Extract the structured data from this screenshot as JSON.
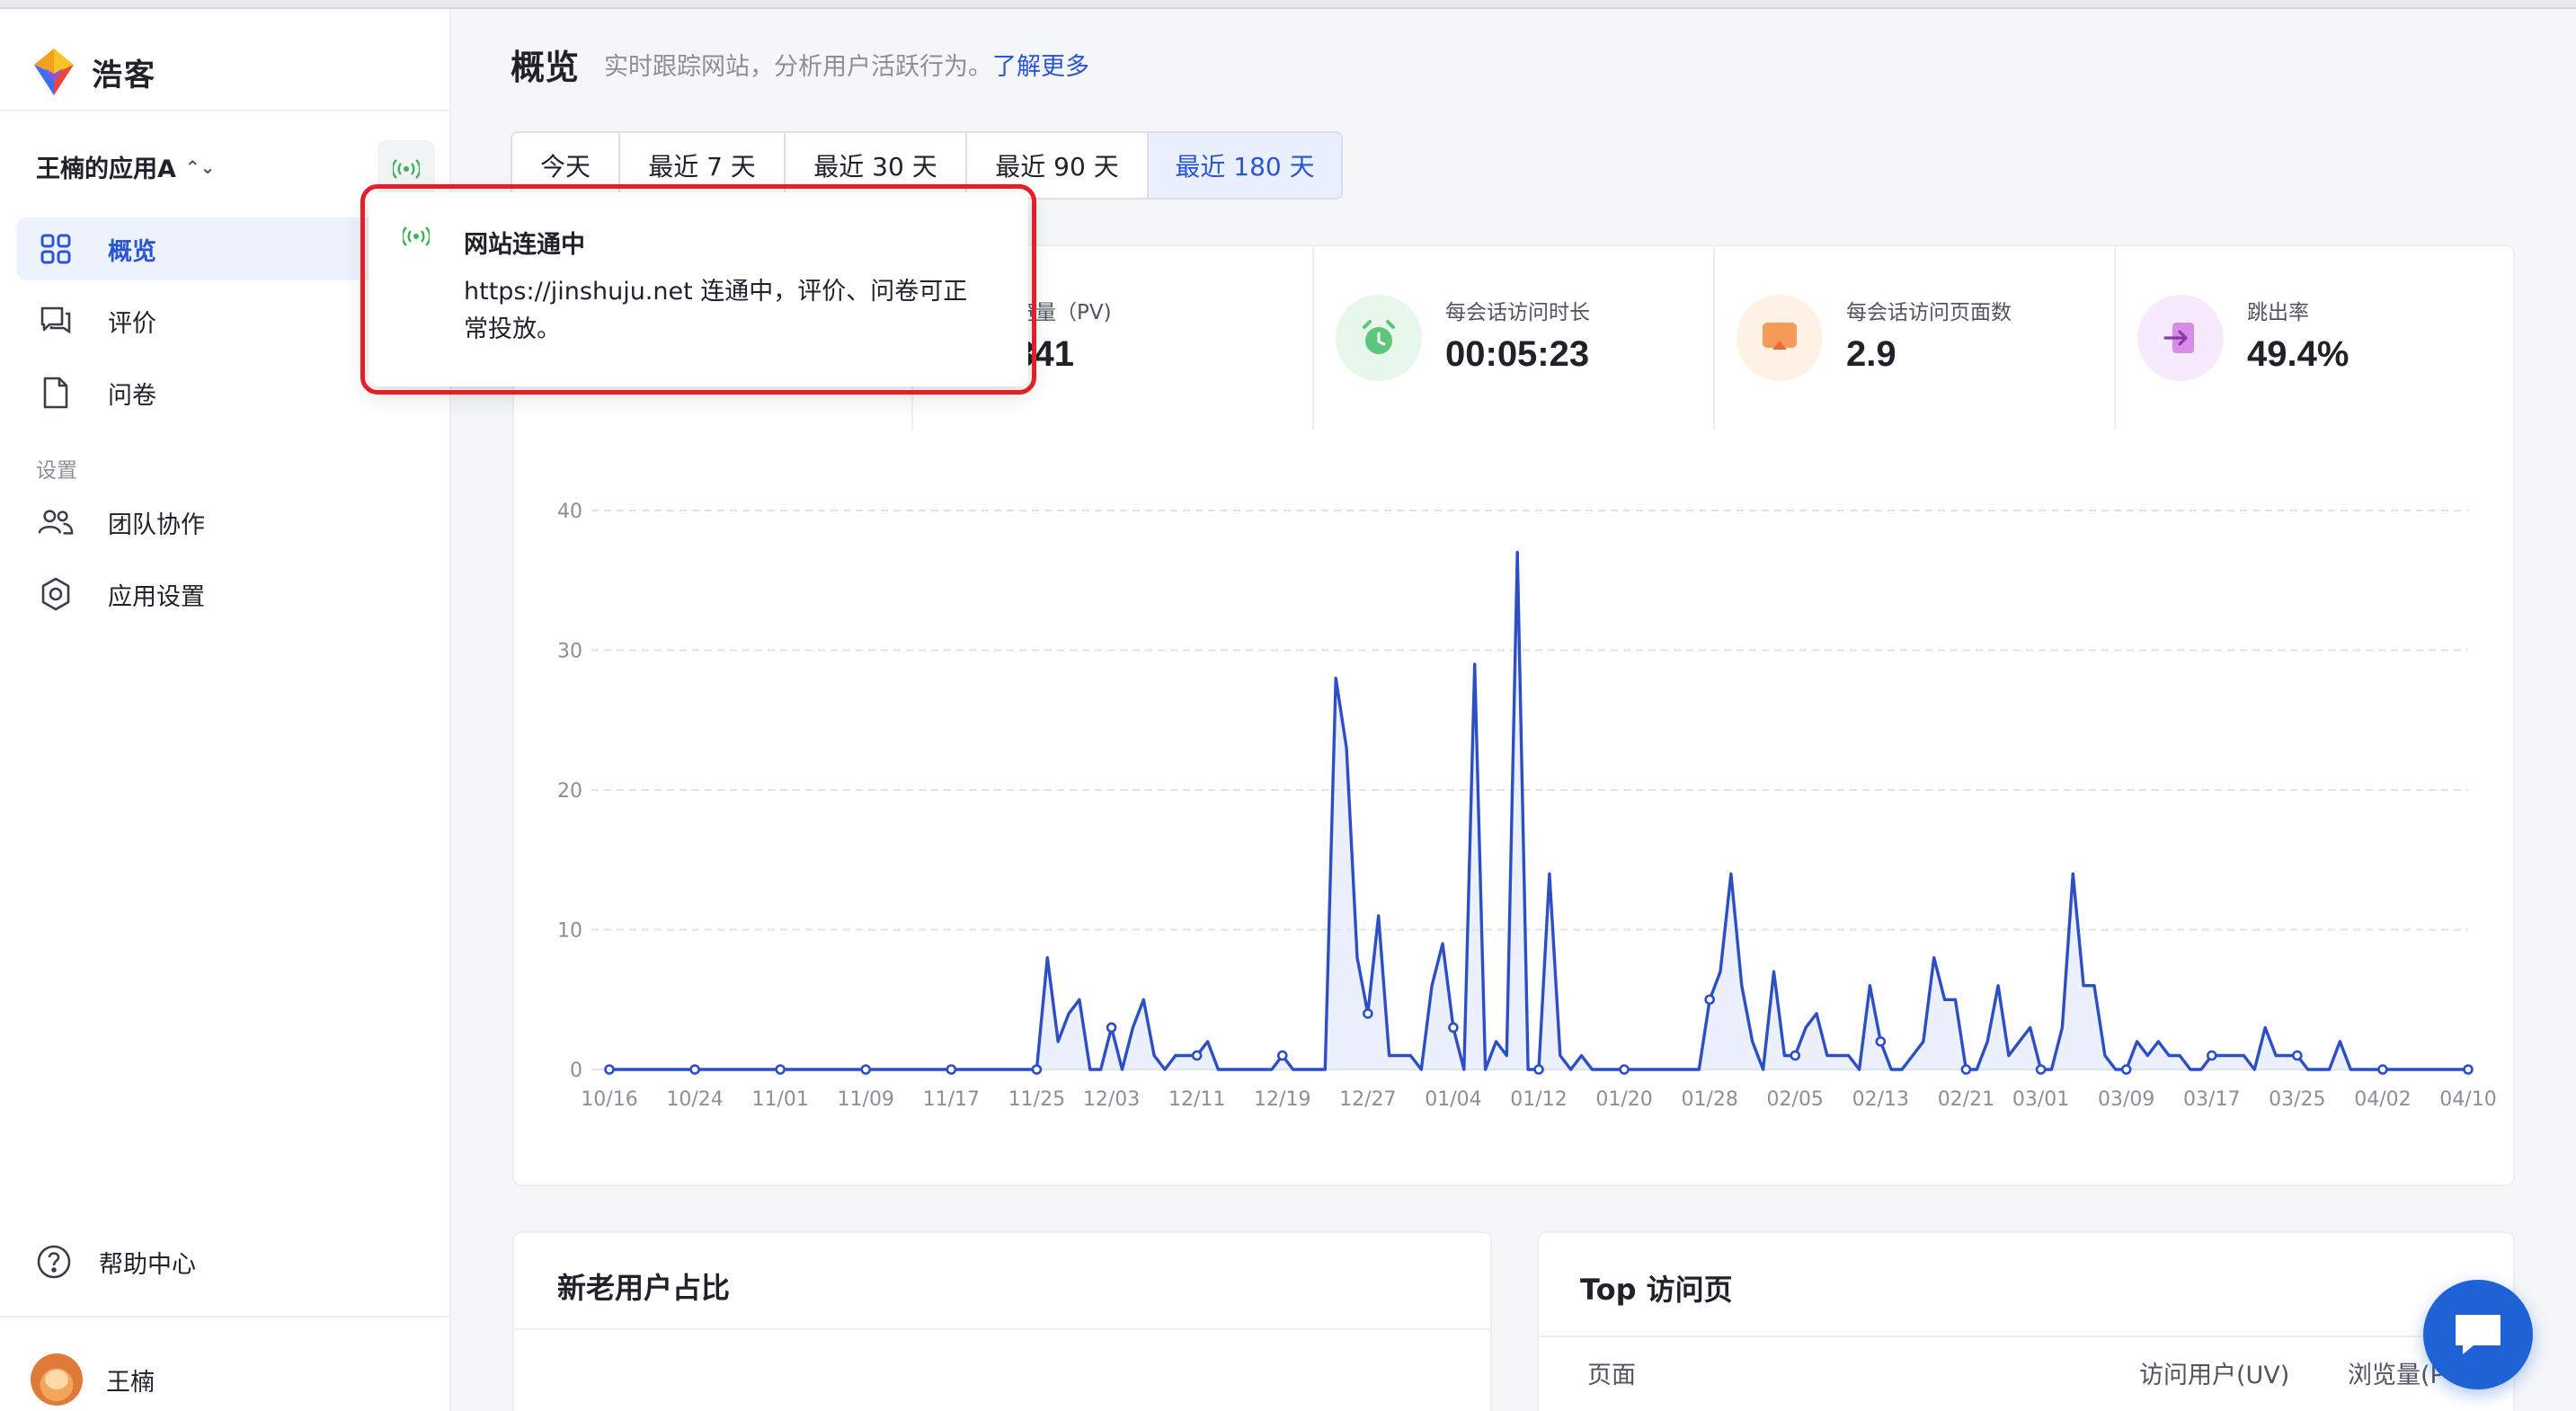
{
  "brand": {
    "name": "浩客"
  },
  "sidebar": {
    "app_name": "王楠的应用A",
    "nav": [
      {
        "label": "概览",
        "icon": "grid-icon",
        "active": true
      },
      {
        "label": "评价",
        "icon": "comment-icon",
        "active": false
      },
      {
        "label": "问卷",
        "icon": "document-icon",
        "active": false
      }
    ],
    "settings_section": "设置",
    "settings_nav": [
      {
        "label": "团队协作",
        "icon": "team-icon"
      },
      {
        "label": "应用设置",
        "icon": "gear-icon"
      }
    ],
    "help_label": "帮助中心",
    "user_name": "王楠"
  },
  "header": {
    "title": "概览",
    "subtitle": "实时跟踪网站，分析用户活跃行为。",
    "learn_more": "了解更多"
  },
  "range_tabs": [
    {
      "label": "今天",
      "active": false
    },
    {
      "label": "最近 7 天",
      "active": false
    },
    {
      "label": "最近 30 天",
      "active": false
    },
    {
      "label": "最近 90 天",
      "active": false
    },
    {
      "label": "最近 180 天",
      "active": true
    }
  ],
  "popover": {
    "title": "网站连通中",
    "body": "https://jinshuju.net 连通中，评价、问卷可正常投放。"
  },
  "stats": [
    {
      "label": "",
      "value": "",
      "icon": "user-icon",
      "color": "#e8eefc"
    },
    {
      "label": "浏览量（PV)",
      "value": "2841",
      "icon": "eye-icon",
      "color": "#eaf4ff"
    },
    {
      "label": "每会话访问时长",
      "value": "00:05:23",
      "icon": "alarm-clock-icon",
      "color": "#e7f7ec"
    },
    {
      "label": "每会话访问页面数",
      "value": "2.9",
      "icon": "page-icon",
      "color": "#fff1e4"
    },
    {
      "label": "跳出率",
      "value": "49.4%",
      "icon": "exit-icon",
      "color": "#f6eafc"
    }
  ],
  "chart_data": {
    "type": "line",
    "x_tick_labels": [
      "10/16",
      "10/24",
      "11/01",
      "11/09",
      "11/17",
      "11/25",
      "12/03",
      "12/11",
      "12/19",
      "12/27",
      "01/04",
      "01/12",
      "01/20",
      "01/28",
      "02/05",
      "02/13",
      "02/21",
      "03/01",
      "03/09",
      "03/17",
      "03/25",
      "04/02",
      "04/10"
    ],
    "y_ticks": [
      0,
      10,
      20,
      30,
      40
    ],
    "ylim": [
      0,
      40
    ],
    "color": "#2d4fc4",
    "series": [
      {
        "values": [
          0,
          0,
          0,
          0,
          0,
          0,
          0,
          0,
          0,
          0,
          0,
          0,
          0,
          0,
          0,
          0,
          0,
          0,
          0,
          0,
          0,
          0,
          0,
          0,
          0,
          0,
          0,
          0,
          0,
          0,
          0,
          0,
          0,
          0,
          0,
          0,
          0,
          0,
          0,
          0,
          0,
          8,
          2,
          4,
          5,
          0,
          0,
          3,
          0,
          3,
          5,
          1,
          0,
          1,
          1,
          1,
          2,
          0,
          0,
          0,
          0,
          0,
          0,
          1,
          0,
          0,
          0,
          0,
          28,
          23,
          8,
          4,
          11,
          1,
          1,
          1,
          0,
          6,
          9,
          3,
          0,
          29,
          0,
          2,
          1,
          37,
          0,
          0,
          14,
          1,
          0,
          1,
          0,
          0,
          0,
          0,
          0,
          0,
          0,
          0,
          0,
          0,
          0,
          5,
          7,
          14,
          6,
          2,
          0,
          7,
          1,
          1,
          3,
          4,
          1,
          1,
          1,
          0,
          6,
          2,
          0,
          0,
          1,
          2,
          8,
          5,
          5,
          0,
          0,
          2,
          6,
          1,
          2,
          3,
          0,
          0,
          3,
          14,
          6,
          6,
          1,
          0,
          0,
          2,
          1,
          2,
          1,
          1,
          0,
          0,
          1,
          1,
          1,
          1,
          0,
          3,
          1,
          1,
          1,
          0,
          0,
          0,
          2,
          0,
          0,
          0,
          0,
          0,
          0,
          0,
          0,
          0,
          0,
          0,
          0
        ]
      }
    ]
  },
  "cards": {
    "new_old_title": "新老用户占比",
    "top_pages_title": "Top 访问页",
    "top_pages_columns": [
      "页面",
      "访问用户(UV)",
      "浏览量(P"
    ]
  }
}
